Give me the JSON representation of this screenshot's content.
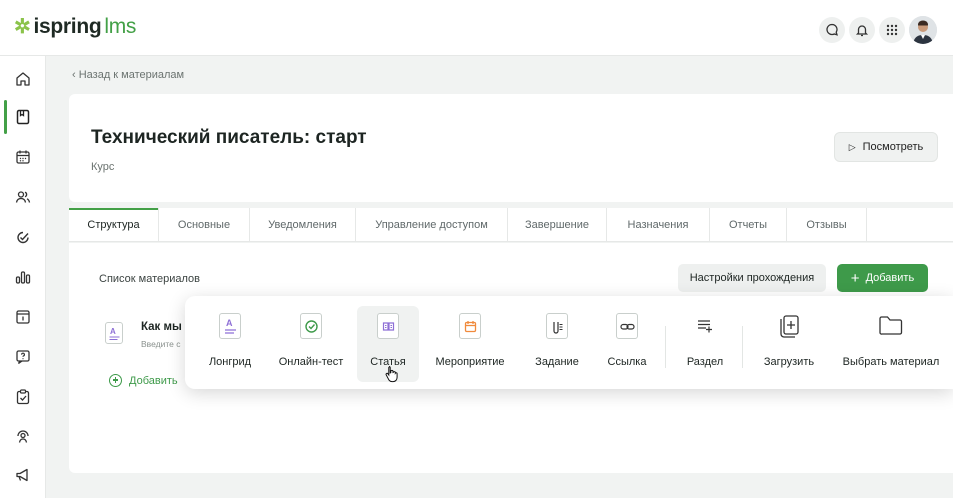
{
  "topbar": {
    "logo_brand": "ispring",
    "logo_lms": "lms"
  },
  "breadcrumb": "‹  Назад к материалам",
  "course": {
    "title": "Технический писатель: старт",
    "subtitle": "Курс",
    "view_button": "Посмотреть"
  },
  "tabs": [
    "Структура",
    "Основные",
    "Уведомления",
    "Управление доступом",
    "Завершение",
    "Назначения",
    "Отчеты",
    "Отзывы"
  ],
  "content": {
    "list_title": "Список материалов",
    "settings_button": "Настройки прохождения",
    "add_button": "Добавить",
    "item_title": "Как мы",
    "item_sub": "Введите с",
    "add_link": "Добавить"
  },
  "popup": {
    "items": [
      "Лонгрид",
      "Онлайн-тест",
      "Статья",
      "Мероприятие",
      "Задание",
      "Ссылка",
      "Раздел",
      "Загрузить",
      "Выбрать материал"
    ]
  },
  "colors": {
    "accent": "#43a047",
    "add_button": "#3e9a4a",
    "longread_icon": "#8e6fd6",
    "test_icon": "#3e9a4a",
    "article_icon": "#8e6fd6",
    "event_icon": "#f08a3c"
  }
}
